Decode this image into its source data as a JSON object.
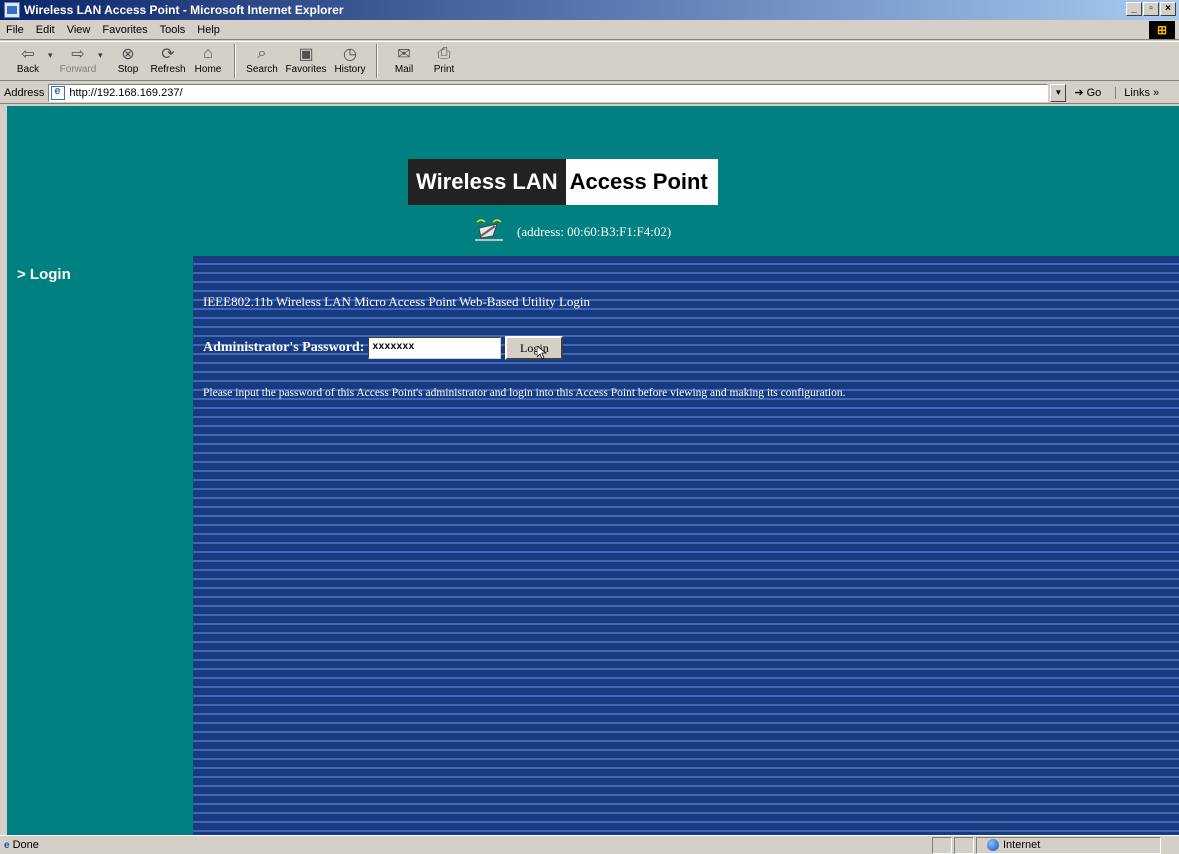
{
  "window": {
    "title": "Wireless LAN Access Point - Microsoft Internet Explorer",
    "controls": [
      "_",
      "▫",
      "×"
    ]
  },
  "menu": [
    "File",
    "Edit",
    "View",
    "Favorites",
    "Tools",
    "Help"
  ],
  "toolbar": {
    "back": "Back",
    "forward": "Forward",
    "stop": "Stop",
    "refresh": "Refresh",
    "home": "Home",
    "search": "Search",
    "favorites": "Favorites",
    "history": "History",
    "mail": "Mail",
    "print": "Print"
  },
  "address_bar": {
    "label": "Address",
    "url": "http://192.168.169.237/",
    "go": "Go",
    "links": "Links »"
  },
  "page": {
    "banner_dark": "Wireless LAN",
    "banner_light": "Access Point",
    "address_text": "(address: 00:60:B3:F1:F4:02)",
    "sidebar_login": "> Login",
    "heading": "IEEE802.11b Wireless LAN Micro Access Point Web-Based Utility Login",
    "password_label": "Administrator's Password:",
    "password_value": "xxxxxxx",
    "login_button": "Login",
    "instruction": "Please input the password of this Access Point's administrator and login into this Access Point before viewing and making its configuration."
  },
  "status_bar": {
    "status": "Done",
    "zone": "Internet"
  },
  "colors": {
    "page_background": "#008080",
    "panel_stripe_dark": "#1a3a80",
    "panel_stripe_light": "#3a6ab8",
    "title_bar": "#0a246a"
  }
}
